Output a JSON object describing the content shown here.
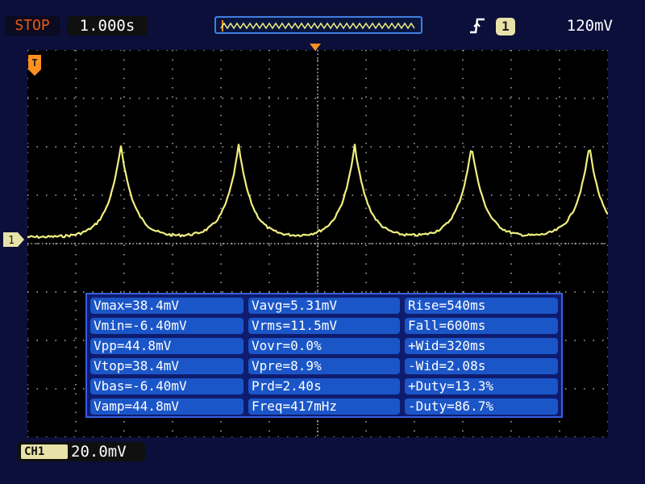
{
  "status": {
    "label": "STOP",
    "color": "#e85a10"
  },
  "timebase": {
    "value": "1.000s"
  },
  "trigger": {
    "edge_icon": "rising-edge-icon",
    "source": "1",
    "level": "120mV"
  },
  "markers": {
    "trigger_marker": "T",
    "channel_marker": "1"
  },
  "colors": {
    "trace": "#f0f080",
    "grid": "#d0d0d0",
    "panel_bg": "#0f1c6e",
    "cell_bg": "#1b56c8"
  },
  "measurements": [
    [
      "Vmax=38.4mV",
      "Vavg=5.31mV",
      "Rise=540ms"
    ],
    [
      "Vmin=-6.40mV",
      "Vrms=11.5mV",
      "Fall=600ms"
    ],
    [
      "Vpp=44.8mV",
      "Vovr=0.0%",
      "+Wid=320ms"
    ],
    [
      "Vtop=38.4mV",
      "Vpre=8.9%",
      "-Wid=2.08s"
    ],
    [
      "Vbas=-6.40mV",
      "Prd=2.40s",
      "+Duty=13.3%"
    ],
    [
      "Vamp=44.8mV",
      "Freq=417mHz",
      "-Duty=86.7%"
    ]
  ],
  "channel": {
    "badge": "CH1",
    "scale": "20.0mV"
  }
}
